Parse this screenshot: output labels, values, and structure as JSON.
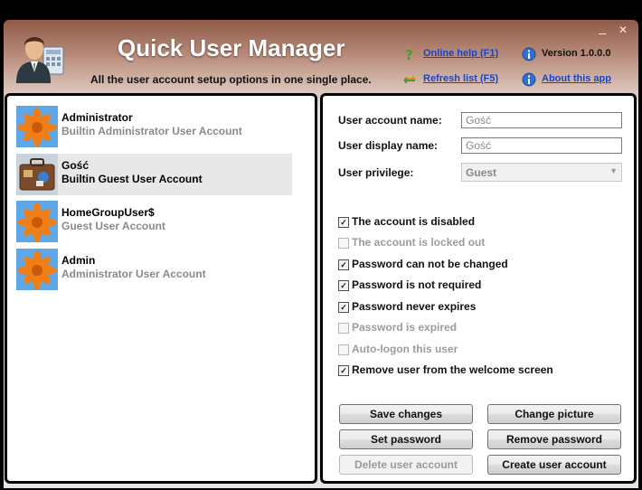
{
  "window": {
    "minimize_glyph": "_",
    "close_glyph": "✕"
  },
  "header": {
    "title": "Quick User Manager",
    "subtitle": "All the user account setup options in one single place.",
    "online_help": "Online help (F1)",
    "refresh_list": "Refresh list (F5)",
    "version": "Version 1.0.0.0",
    "about": "About this app",
    "icons": {
      "logo": "user-manager-logo-icon",
      "help": "help-question-icon",
      "refresh": "refresh-arrows-icon",
      "version_info": "info-icon",
      "about_info": "info-icon"
    }
  },
  "users": [
    {
      "name": "Administrator",
      "description": "Builtin Administrator User Account",
      "picture": "orange-flower",
      "selected": false
    },
    {
      "name": "Gość",
      "description": "Builtin Guest User Account",
      "picture": "suitcase",
      "selected": true
    },
    {
      "name": "HomeGroupUser$",
      "description": "Guest User Account",
      "picture": "orange-flower",
      "selected": false
    },
    {
      "name": "Admin",
      "description": "Administrator User Account",
      "picture": "orange-flower",
      "selected": false
    }
  ],
  "details": {
    "account_name_label": "User account name:",
    "account_name_value": "Gość",
    "display_name_label": "User display name:",
    "display_name_value": "Gość",
    "privilege_label": "User privilege:",
    "privilege_value": "Guest"
  },
  "options": [
    {
      "label": "The account is disabled",
      "checked": true,
      "enabled": true
    },
    {
      "label": "The account is locked out",
      "checked": false,
      "enabled": false
    },
    {
      "label": "Password can not be changed",
      "checked": true,
      "enabled": true
    },
    {
      "label": "Password is not required",
      "checked": true,
      "enabled": true
    },
    {
      "label": "Password never expires",
      "checked": true,
      "enabled": true
    },
    {
      "label": "Password is expired",
      "checked": false,
      "enabled": false
    },
    {
      "label": "Auto-logon this user",
      "checked": false,
      "enabled": false
    },
    {
      "label": "Remove user from the welcome screen",
      "checked": true,
      "enabled": true
    }
  ],
  "buttons": {
    "save_changes": "Save changes",
    "change_picture": "Change picture",
    "set_password": "Set password",
    "remove_password": "Remove password",
    "delete_user_account": "Delete user account",
    "create_user_account": "Create user account"
  },
  "colors": {
    "title_bar": "#8f5a48",
    "link": "#1a44c8",
    "selected_row": "#e8e8e8"
  }
}
